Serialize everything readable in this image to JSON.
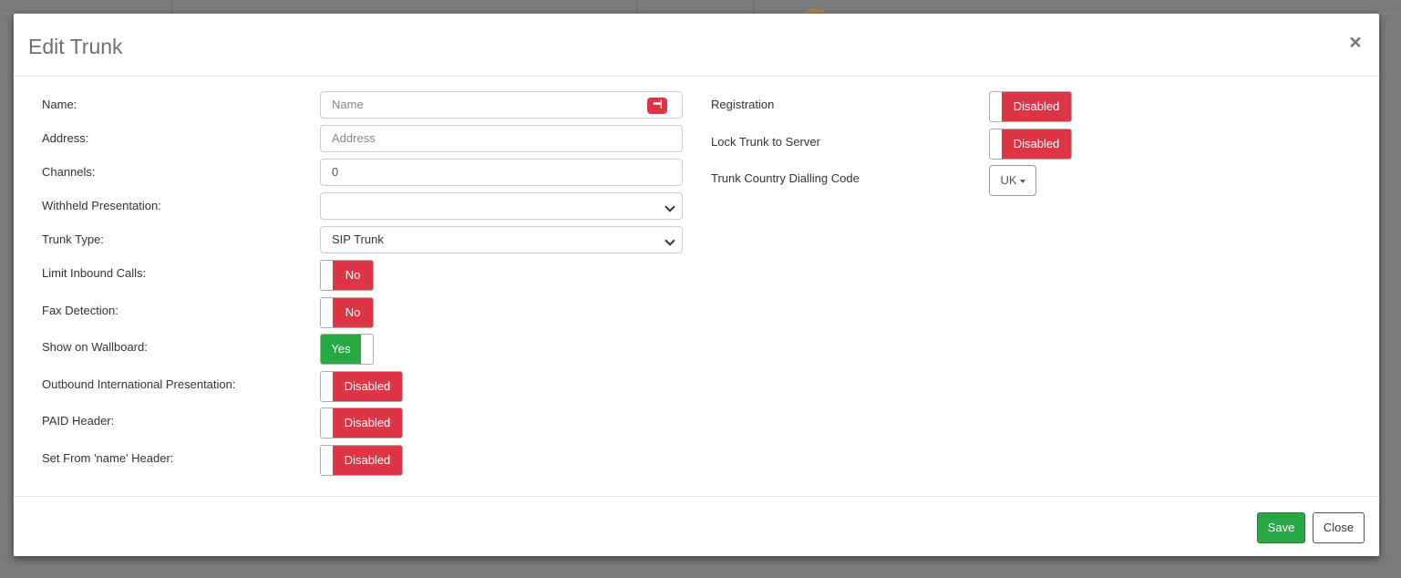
{
  "modal": {
    "title": "Edit Trunk",
    "close_symbol": "×"
  },
  "fields": {
    "name": {
      "label": "Name:",
      "placeholder": "Name",
      "icon": "password-dots-icon"
    },
    "address": {
      "label": "Address:",
      "placeholder": "Address"
    },
    "channels": {
      "label": "Channels:",
      "value": "0"
    },
    "withheld_presentation": {
      "label": "Withheld Presentation:",
      "value": ""
    },
    "trunk_type": {
      "label": "Trunk Type:",
      "value": "SIP Trunk"
    },
    "limit_inbound_calls": {
      "label": "Limit Inbound Calls:",
      "state": "No"
    },
    "fax_detection": {
      "label": "Fax Detection:",
      "state": "No"
    },
    "show_on_wallboard": {
      "label": "Show on Wallboard:",
      "state": "Yes"
    },
    "outbound_international_presentation": {
      "label": "Outbound International Presentation:",
      "state": "Disabled"
    },
    "paid_header": {
      "label": "PAID Header:",
      "state": "Disabled"
    },
    "set_from_name_header": {
      "label": "Set From 'name' Header:",
      "state": "Disabled"
    }
  },
  "right_fields": {
    "registration": {
      "label": "Registration",
      "state": "Disabled"
    },
    "lock_trunk_to_server": {
      "label": "Lock Trunk to Server",
      "state": "Disabled"
    },
    "trunk_country_dialling_code": {
      "label": "Trunk Country Dialling Code",
      "value": "UK"
    }
  },
  "footer": {
    "save_label": "Save",
    "close_label": "Close"
  },
  "colors": {
    "danger": "#dc3545",
    "success": "#28a745"
  }
}
